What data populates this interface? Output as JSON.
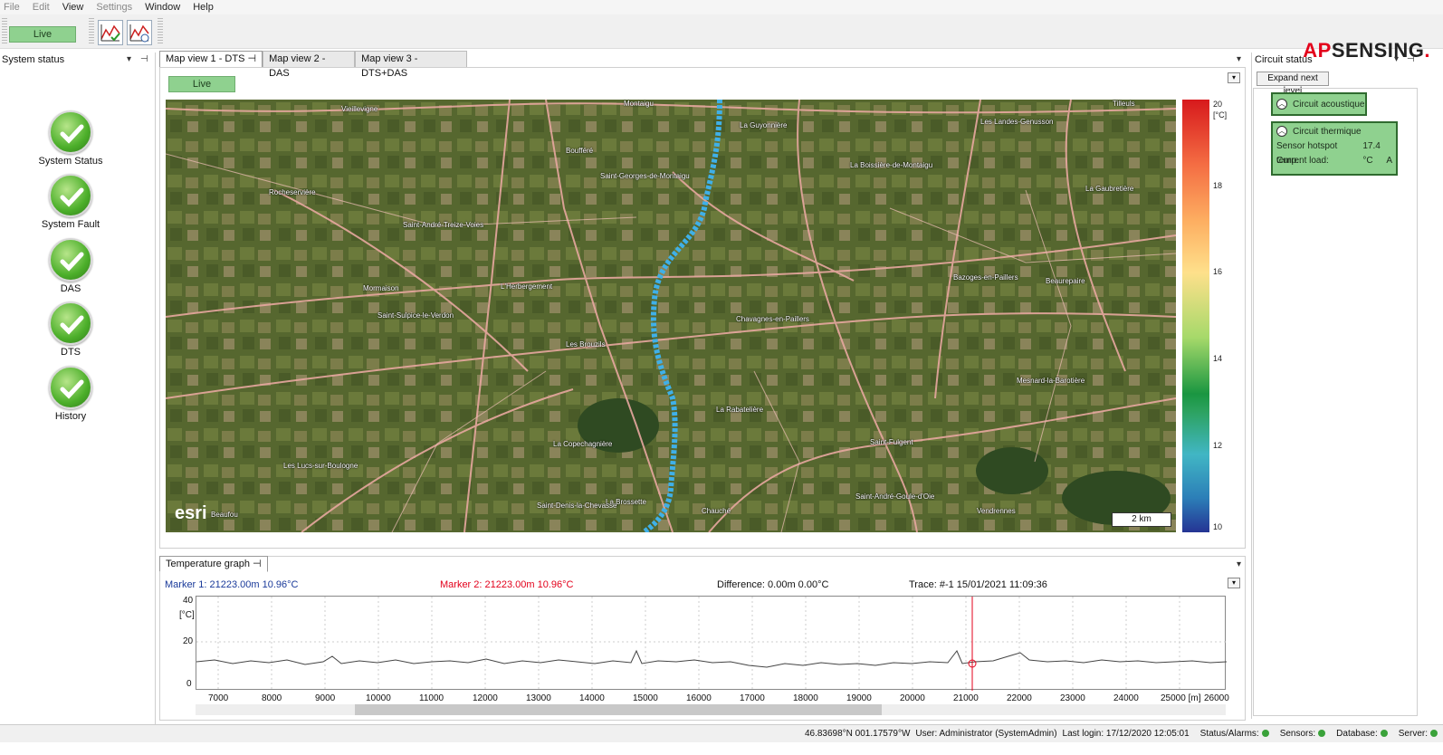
{
  "menu": [
    {
      "label": "File",
      "disabled": true
    },
    {
      "label": "Edit",
      "disabled": true
    },
    {
      "label": "View",
      "disabled": false
    },
    {
      "label": "Settings",
      "disabled": true
    },
    {
      "label": "Window",
      "disabled": false
    },
    {
      "label": "Help",
      "disabled": false
    }
  ],
  "toolbar": {
    "live_label": "Live",
    "logo_red": "AP",
    "logo_black": "SENSING",
    "logo_dot": "."
  },
  "system_status": {
    "title": "System status",
    "items": [
      {
        "label": "System Status",
        "state": "ok"
      },
      {
        "label": "System Fault",
        "state": "ok"
      },
      {
        "label": "DAS",
        "state": "ok"
      },
      {
        "label": "DTS",
        "state": "ok"
      },
      {
        "label": "History",
        "state": "ok"
      }
    ]
  },
  "tabs": [
    "Map view 1 - DTS",
    "Map view 2 - DAS",
    "Map view 3 - DTS+DAS"
  ],
  "map": {
    "live_label": "Live",
    "esri": "esri",
    "scale": "2 km",
    "labels": [
      "Vieillevigne",
      "Montaigu",
      "La Guyonnière",
      "Les Landes-Genusson",
      "Tilleuls",
      "Boufféré",
      "Saint-Georges-de-Montaigu",
      "La Boissière-de-Montaigu",
      "La Gaubretière",
      "Rocheservière",
      "Saint-André-Treize-Voies",
      "Bazoges-en-Paillers",
      "Beaurepaire",
      "Mormaison",
      "L'Herbergement",
      "Saint-Sulpice-le-Verdon",
      "Chavagnes-en-Paillers",
      "Les Brouzils",
      "La Rabatelière",
      "Mesnard-la-Barotière",
      "Saint-Fulgent",
      "La Copechagnière",
      "Les Lucs-sur-Boulogne",
      "La Brossette",
      "Chauché",
      "Saint-Denis-la-Chevasse",
      "Saint-André-Goule-d'Oie",
      "Vendrennes",
      "Beaufou"
    ],
    "colorbar_unit": "[°C]",
    "colorbar_ticks": [
      "20",
      "18",
      "16",
      "14",
      "12",
      "10"
    ]
  },
  "graph": {
    "title": "Temperature graph",
    "marker1": "Marker 1: 21223.00m 10.96°C",
    "marker2": "Marker 2: 21223.00m 10.96°C",
    "difference": "Difference: 0.00m 0.00°C",
    "trace": "Trace: #-1 15/01/2021 11:09:36",
    "y_unit": "[°C]",
    "y_ticks": [
      "40",
      "20",
      "0"
    ],
    "x_ticks": [
      "7000",
      "8000",
      "9000",
      "10000",
      "11000",
      "12000",
      "13000",
      "14000",
      "15000",
      "16000",
      "17000",
      "18000",
      "19000",
      "20000",
      "21000",
      "22000",
      "23000",
      "24000",
      "25000 [m]",
      "26000"
    ]
  },
  "circuit_status": {
    "title": "Circuit status",
    "expand_label": "Expand next level",
    "circuits": [
      {
        "name": "Circuit acoustique",
        "rows": []
      },
      {
        "name": "Circuit thermique",
        "rows": [
          {
            "label": "Sensor hotspot temp.:",
            "value": "17.4 °C"
          },
          {
            "label": "Current load:",
            "value": "A"
          }
        ]
      }
    ]
  },
  "statusbar": {
    "coords": "46.83698°N  001.17579°W",
    "user": "User: Administrator (SystemAdmin)",
    "last_login": "Last login: 17/12/2020 12:05:01",
    "alarms": "Status/Alarms:",
    "sensors": "Sensors:",
    "database": "Database:",
    "server": "Server:"
  },
  "colors": {
    "ok_green": "#4caf2a",
    "live_green": "#8fd18f",
    "marker2_red": "#e3001b",
    "marker1_blue": "#1a3a9a"
  }
}
